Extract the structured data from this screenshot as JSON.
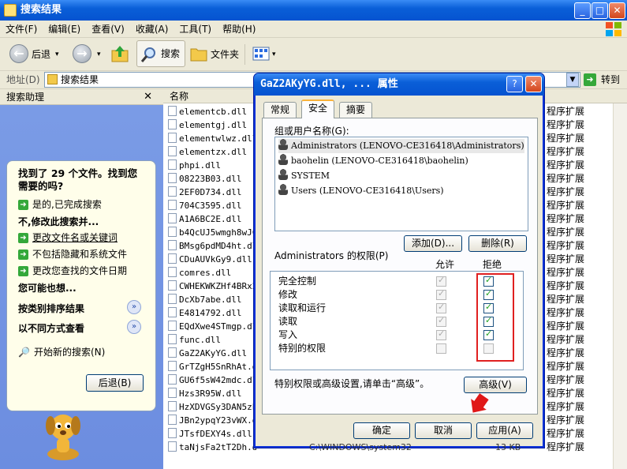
{
  "window": {
    "title": "搜索结果"
  },
  "menu": [
    "文件(F)",
    "编辑(E)",
    "查看(V)",
    "收藏(A)",
    "工具(T)",
    "帮助(H)"
  ],
  "toolbar": {
    "back": "后退",
    "search": "搜索",
    "folders": "文件夹"
  },
  "address": {
    "label": "地址(D)",
    "value": "搜索结果",
    "go": "转到"
  },
  "assistant": {
    "title": "搜索助理",
    "found": "找到了 29 个文件。找到您需要的吗?",
    "yes": "是的,已完成搜索",
    "refine": "不,修改此搜索并...",
    "opt1": "更改文件名或关键词",
    "opt2": "不包括隐藏和系统文件",
    "opt3": "更改您查找的文件日期",
    "maybe": "您可能也想...",
    "sort": "按类别排序结果",
    "view": "以不同方式查看",
    "newsearch": "开始新的搜索(N)",
    "back": "后退(B)"
  },
  "filelist": {
    "col_name": "名称",
    "type_text": "程序扩展",
    "files": [
      "elementcb.dll",
      "elementgj.dll",
      "elementwlwz.dll",
      "elementzx.dll",
      "phpi.dll",
      "08223B03.dll",
      "2EF0D734.dll",
      "704C3595.dll",
      "A1A6BC2E.dll",
      "b4QcUJ5wmgh8wJCk",
      "BMsg6pdMD4ht.dll",
      "CDuAUVkGy9.dll",
      "comres.dll",
      "CWHEKWKZHf4BRx2m",
      "DcXb7abe.dll",
      "E4814792.dll",
      "EQdXwe4STmgp.dll",
      "func.dll",
      "GaZ2AKyYG.dll",
      "GrTZgH5SnRhAt.dll",
      "GU6f5sW42mdc.dll",
      "Hzs3R95W.dll",
      "HzXDVGSy3DAN5zPK",
      "JBn2ypqY23vWX.dll",
      "JTsfDEXY4s.dll",
      "taNjsFa2tT2Dh.dll"
    ],
    "partial_row": "C:\\WINDOWS\\system32",
    "partial_size": "13 KB"
  },
  "dialog": {
    "title": "GaZ2AKyYG.dll, ... 属性",
    "tabs": [
      "常规",
      "安全",
      "摘要"
    ],
    "groups_label": "组或用户名称(G):",
    "users": [
      "Administrators (LENOVO-CE316418\\Administrators)",
      "baohelin (LENOVO-CE316418\\baohelin)",
      "SYSTEM",
      "Users (LENOVO-CE316418\\Users)"
    ],
    "add": "添加(D)...",
    "remove": "删除(R)",
    "perm_label": "Administrators 的权限(P)",
    "allow": "允许",
    "deny": "拒绝",
    "perms": [
      {
        "name": "完全控制",
        "allow": true,
        "deny": true
      },
      {
        "name": "修改",
        "allow": true,
        "deny": true
      },
      {
        "name": "读取和运行",
        "allow": true,
        "deny": true
      },
      {
        "name": "读取",
        "allow": true,
        "deny": true
      },
      {
        "name": "写入",
        "allow": true,
        "deny": true
      },
      {
        "name": "特别的权限",
        "allow": false,
        "deny": false
      }
    ],
    "special_note": "特别权限或高级设置,请单击“高级”。",
    "advanced": "高级(V)",
    "ok": "确定",
    "cancel": "取消",
    "apply": "应用(A)"
  }
}
